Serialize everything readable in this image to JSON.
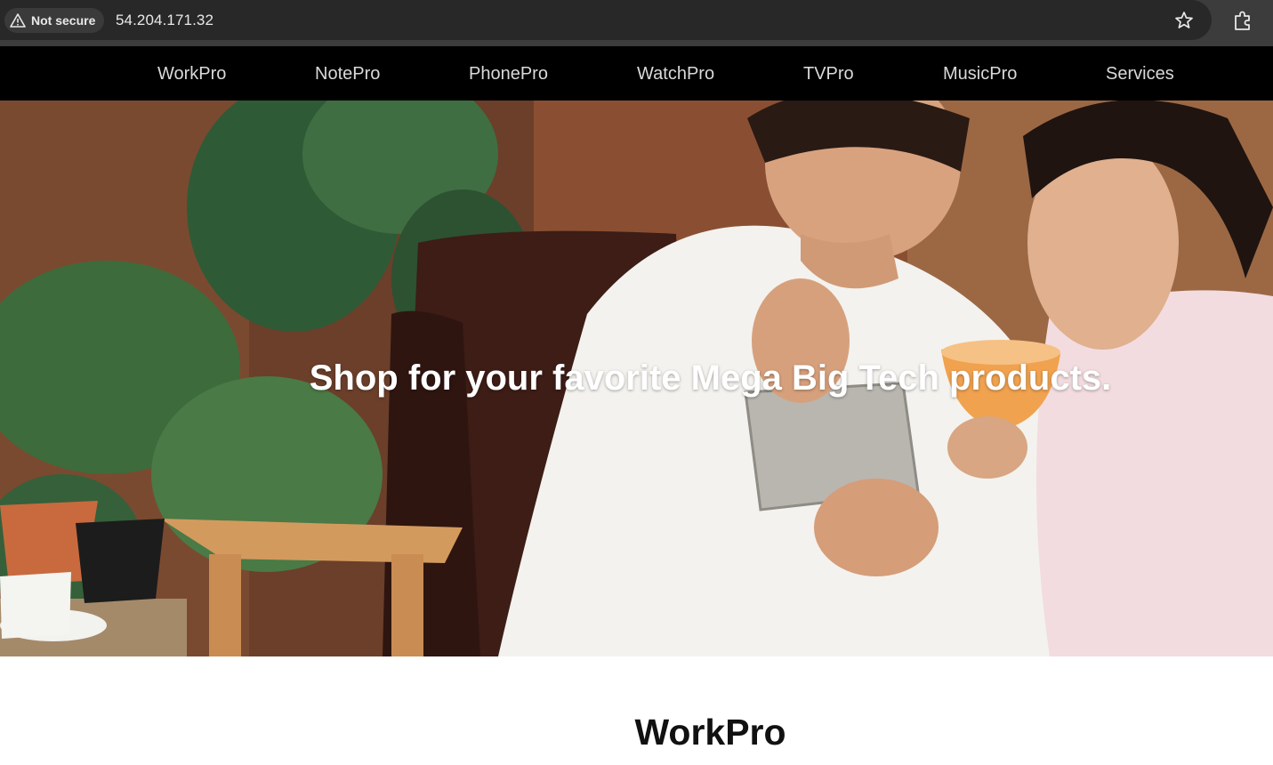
{
  "browser": {
    "security_label": "Not secure",
    "url": "54.204.171.32"
  },
  "nav": {
    "items": [
      {
        "label": "WorkPro"
      },
      {
        "label": "NotePro"
      },
      {
        "label": "PhonePro"
      },
      {
        "label": "WatchPro"
      },
      {
        "label": "TVPro"
      },
      {
        "label": "MusicPro"
      },
      {
        "label": "Services"
      }
    ]
  },
  "hero": {
    "headline": "Shop for your favorite Mega Big Tech products."
  },
  "section": {
    "title": "WorkPro"
  },
  "colors": {
    "chrome_bg": "#282828",
    "nav_bg": "#000000",
    "nav_text": "#d9d9d9",
    "hero_text": "#ffffff"
  }
}
